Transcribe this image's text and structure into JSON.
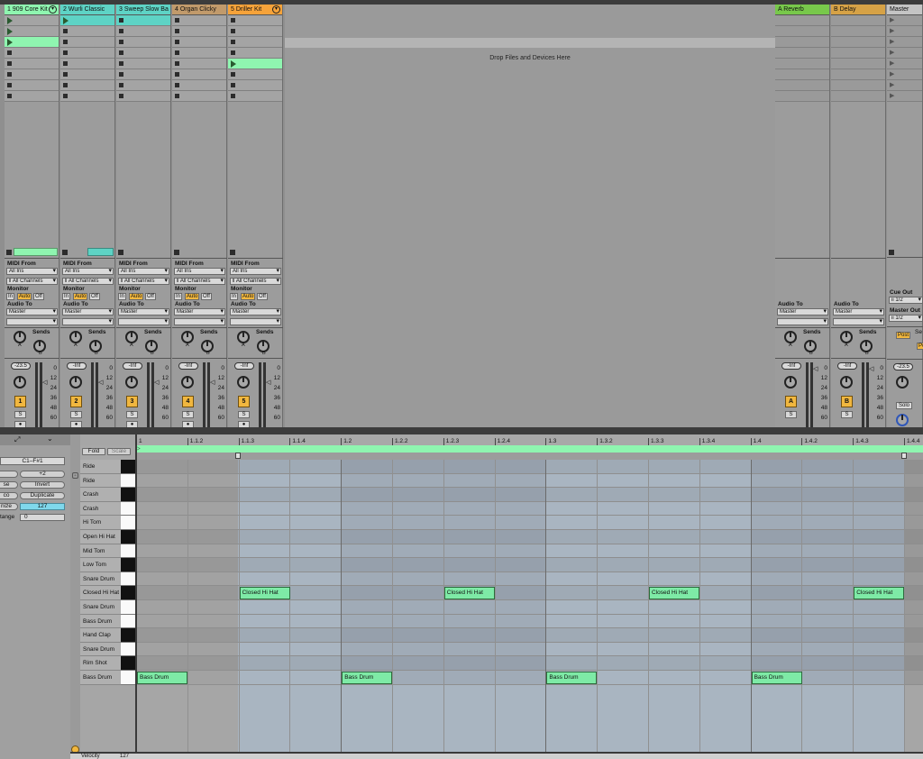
{
  "session": {
    "tracks": [
      {
        "name": "1 909 Core Kit",
        "color": "#8ff5b0",
        "num": "1",
        "volume": "-23.5",
        "slots": [
          "play",
          "play",
          "play-filled",
          "stop",
          "stop",
          "stop",
          "stop",
          "stop"
        ]
      },
      {
        "name": "2 Wurli Classic",
        "color": "#5ed3c5",
        "num": "2",
        "volume": "-Inf",
        "slots": [
          "play-filled",
          "stop",
          "stop",
          "stop",
          "stop",
          "stop",
          "stop",
          "stop"
        ]
      },
      {
        "name": "3 Sweep Slow Ba",
        "color": "#5ed3c5",
        "num": "3",
        "volume": "-Inf",
        "slots": [
          "stop-filled",
          "stop",
          "stop",
          "stop",
          "stop",
          "stop",
          "stop",
          "stop"
        ]
      },
      {
        "name": "4 Organ Clicky",
        "color": "#c19a6b",
        "num": "4",
        "volume": "-Inf",
        "slots": [
          "stop",
          "stop",
          "stop",
          "stop",
          "stop",
          "stop",
          "stop",
          "stop"
        ]
      },
      {
        "name": "5 Driller Kit",
        "color": "#f6a33a",
        "num": "5",
        "volume": "-Inf",
        "slots": [
          "stop",
          "stop",
          "stop",
          "stop",
          "play-green",
          "stop",
          "stop",
          "stop"
        ]
      }
    ],
    "drop_text": "Drop Files and Devices Here",
    "returns": [
      {
        "name": "A Reverb",
        "color": "#78c84b",
        "letter": "A",
        "volume": "-Inf"
      },
      {
        "name": "B Delay",
        "color": "#d6a246",
        "letter": "B",
        "volume": "-Inf"
      }
    ],
    "master": {
      "name": "Master",
      "volume": "-23.5",
      "cue_out_label": "Cue Out",
      "cue_out": "ii 1/2",
      "master_out_label": "Master Out",
      "master_out": "ii 1/2",
      "solo": "Solo",
      "post": "Post",
      "sends_partial": "Se",
      "post_partial": "Po"
    },
    "io": {
      "midi_from": "MIDI From",
      "all_ins": "All Ins",
      "all_channels": "All Channels",
      "monitor": "Monitor",
      "in": "In",
      "auto": "Auto",
      "off": "Off",
      "audio_to": "Audio To",
      "master": "Master",
      "sends": "Sends"
    },
    "db_scale": [
      "0",
      "12",
      "24",
      "36",
      "48",
      "60"
    ],
    "solo_btn": "S",
    "send_a": "A",
    "send_b": "B"
  },
  "detail": {
    "range": "C1–F#1",
    "transpose_up": "+2",
    "invert": "Invert",
    "duplicate": "Duplicate",
    "reverse_partial": "se",
    "legato_partial": "co",
    "quantize_partial": "nize",
    "quantize_value": "127",
    "range_partial": "tange",
    "range_value": "0",
    "fold": "Fold",
    "scale": "Scale",
    "velocity_label": "Velocity",
    "velocity_value": "127",
    "ruler": [
      "1",
      "1.1.2",
      "1.1.3",
      "1.1.4",
      "1.2",
      "1.2.2",
      "1.2.3",
      "1.2.4",
      "1.3",
      "1.3.2",
      "1.3.3",
      "1.3.4",
      "1.4",
      "1.4.2",
      "1.4.3",
      "1.4.4"
    ],
    "rows": [
      "Ride",
      "Ride",
      "Crash",
      "Crash",
      "Hi Tom",
      "Open Hi Hat",
      "Mid Tom",
      "Low Tom",
      "Snare Drum",
      "Closed Hi Hat",
      "Snare Drum",
      "Bass Drum",
      "Hand Clap",
      "Snare Drum",
      "Rim Shot",
      "Bass Drum"
    ],
    "notes": [
      {
        "label": "Closed Hi Hat",
        "row": 9,
        "step": 2
      },
      {
        "label": "Closed Hi Hat",
        "row": 9,
        "step": 6
      },
      {
        "label": "Closed Hi Hat",
        "row": 9,
        "step": 10
      },
      {
        "label": "Closed Hi Hat",
        "row": 9,
        "step": 14
      },
      {
        "label": "Bass Drum",
        "row": 15,
        "step": 0
      },
      {
        "label": "Bass Drum",
        "row": 15,
        "step": 4
      },
      {
        "label": "Bass Drum",
        "row": 15,
        "step": 8
      },
      {
        "label": "Bass Drum",
        "row": 15,
        "step": 12
      }
    ]
  }
}
